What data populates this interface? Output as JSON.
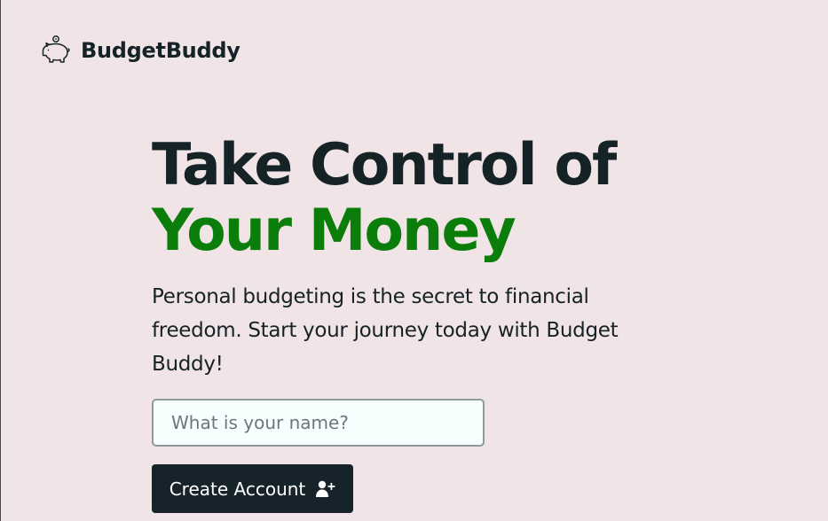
{
  "header": {
    "brand": "BudgetBuddy",
    "logo_icon": "piggy-bank-icon"
  },
  "hero": {
    "title_line1": "Take Control of",
    "title_line2": "Your Money",
    "subtitle": "Personal budgeting is the secret to financial freedom. Start your journey today with Budget Buddy!",
    "name_placeholder": "What is your name?",
    "name_value": "",
    "create_button_label": "Create Account",
    "create_button_icon": "user-plus-icon"
  },
  "colors": {
    "background": "#f1e4e6",
    "accent": "#0a7d0a",
    "text": "#152226",
    "button": "#17232a"
  }
}
